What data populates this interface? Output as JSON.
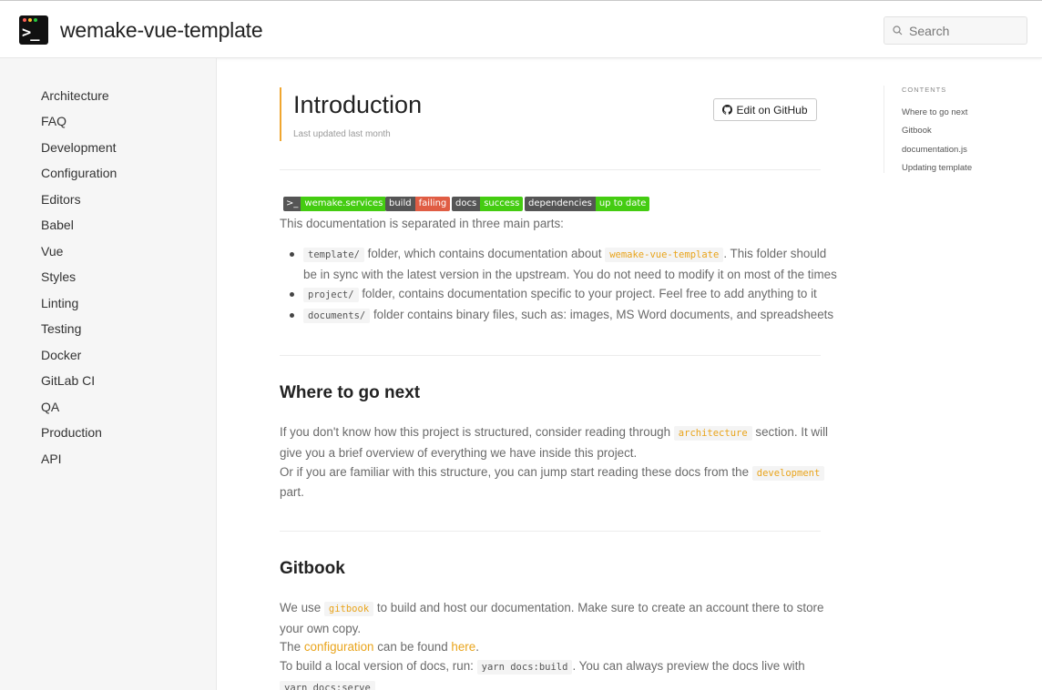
{
  "header": {
    "site_title": "wemake-vue-template",
    "search_placeholder": "Search"
  },
  "colors": {
    "accent": "#e9a41b",
    "sidebar_bg": "#f6f6f6",
    "badge_green": "#44cc11",
    "badge_red": "#e05d44"
  },
  "sidebar": {
    "items": [
      "Architecture",
      "FAQ",
      "Development",
      "Configuration",
      "Editors",
      "Babel",
      "Vue",
      "Styles",
      "Linting",
      "Testing",
      "Docker",
      "GitLab CI",
      "QA",
      "Production",
      "API"
    ]
  },
  "page": {
    "title": "Introduction",
    "last_updated": "Last updated last month",
    "edit_button": "Edit on GitHub"
  },
  "badges": [
    {
      "left": "wemake.services",
      "right": "",
      "color": "#44cc11"
    },
    {
      "left": "build",
      "right": "failing",
      "color": "#e05d44"
    },
    {
      "left": "docs",
      "right": "success",
      "color": "#44cc11"
    },
    {
      "left": "dependencies",
      "right": "up to date",
      "color": "#44cc11"
    }
  ],
  "intro": {
    "lead": "This documentation is separated in three main parts:",
    "item1_code": "template/",
    "item1_a": "folder, which contains documentation about",
    "item1_code2": "wemake-vue-template",
    "item1_b": ". This folder should",
    "item1_c": "be in sync with the latest version in the upstream. You do not need to modify it on most of the times",
    "item2_code": "project/",
    "item2_text": "folder, contains documentation specific to your project. Feel free to add anything to it",
    "item3_code": "documents/",
    "item3_text": "folder contains binary files, such as: images, MS Word documents, and spreadsheets"
  },
  "where_next": {
    "heading": "Where to go next",
    "p1_a": "If you don't know how this project is structured, consider reading through",
    "p1_code": "architecture",
    "p1_b": "section. It will",
    "p1_c": "give you a brief overview of everything we have inside this project.",
    "p2_a": "Or if you are familiar with this structure, you can jump start reading these docs from the",
    "p2_code": "development",
    "p2_b": "part."
  },
  "gitbook": {
    "heading": "Gitbook",
    "p1_a": "We use",
    "p1_code": "gitbook",
    "p1_b": "to build and host our documentation. Make sure to create an account there to store",
    "p1_c": "your own copy.",
    "p2_a": "The",
    "p2_link": "configuration",
    "p2_b": "can be found",
    "p2_link2": "here",
    "p2_c": ".",
    "p3_a": "To build a local version of docs, run:",
    "p3_code": "yarn docs:build",
    "p3_b": ". You can always preview the docs live with",
    "p3_code2": "yarn docs:serve"
  },
  "toc": {
    "title": "CONTENTS",
    "items": [
      "Where to go next",
      "Gitbook",
      "documentation.js",
      "Updating template"
    ]
  }
}
